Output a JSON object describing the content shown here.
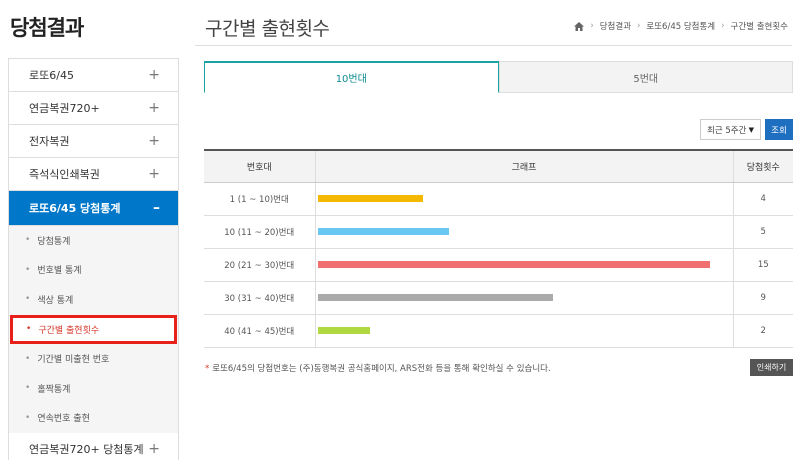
{
  "sidebar": {
    "title": "당첨결과",
    "items": [
      {
        "label": "로또6/45",
        "icon": "plus-icon",
        "symbol": "+"
      },
      {
        "label": "연금복권720+",
        "icon": "plus-icon",
        "symbol": "+"
      },
      {
        "label": "전자복권",
        "icon": "plus-icon",
        "symbol": "+"
      },
      {
        "label": "즉석식인쇄복권",
        "icon": "plus-icon",
        "symbol": "+"
      },
      {
        "label": "로또6/45 당첨통계",
        "icon": "minus-icon",
        "symbol": "–"
      }
    ],
    "submenu": [
      "당첨통계",
      "번호별 통계",
      "색상 통계",
      "구간별 출현횟수",
      "기간별 미출현 번호",
      "홀짝통계",
      "연속번호 출현"
    ],
    "bottom_item": {
      "label": "연금복권720+ 당첨통계",
      "symbol": "+"
    }
  },
  "header": {
    "title": "구간별 출현횟수",
    "breadcrumb": [
      "당첨결과",
      "로또6/45 당첨통계",
      "구간별 출현횟수"
    ]
  },
  "tabs": [
    "10번대",
    "5번대"
  ],
  "filter": {
    "selected": "최근 5주간",
    "button": "조회"
  },
  "table": {
    "headers": [
      "번호대",
      "그래프",
      "당첨횟수"
    ],
    "rows": [
      {
        "range": "1 (1 ~ 10)번대",
        "count": "4",
        "value": 4,
        "color": "#f5b800"
      },
      {
        "range": "10 (11 ~ 20)번대",
        "count": "5",
        "value": 5,
        "color": "#69c8f2"
      },
      {
        "range": "20 (21 ~ 30)번대",
        "count": "15",
        "value": 15,
        "color": "#f07070"
      },
      {
        "range": "30 (31 ~ 40)번대",
        "count": "9",
        "value": 9,
        "color": "#aaaaaa"
      },
      {
        "range": "40 (41 ~ 45)번대",
        "count": "2",
        "value": 2,
        "color": "#b0d840"
      }
    ]
  },
  "note": {
    "star": "*",
    "text": "로또6/45의 당첨번호는 (주)동행복권 공식홈페이지, ARS전화 등을 통해 확인하실 수 있습니다."
  },
  "print_button": "인쇄하기"
}
